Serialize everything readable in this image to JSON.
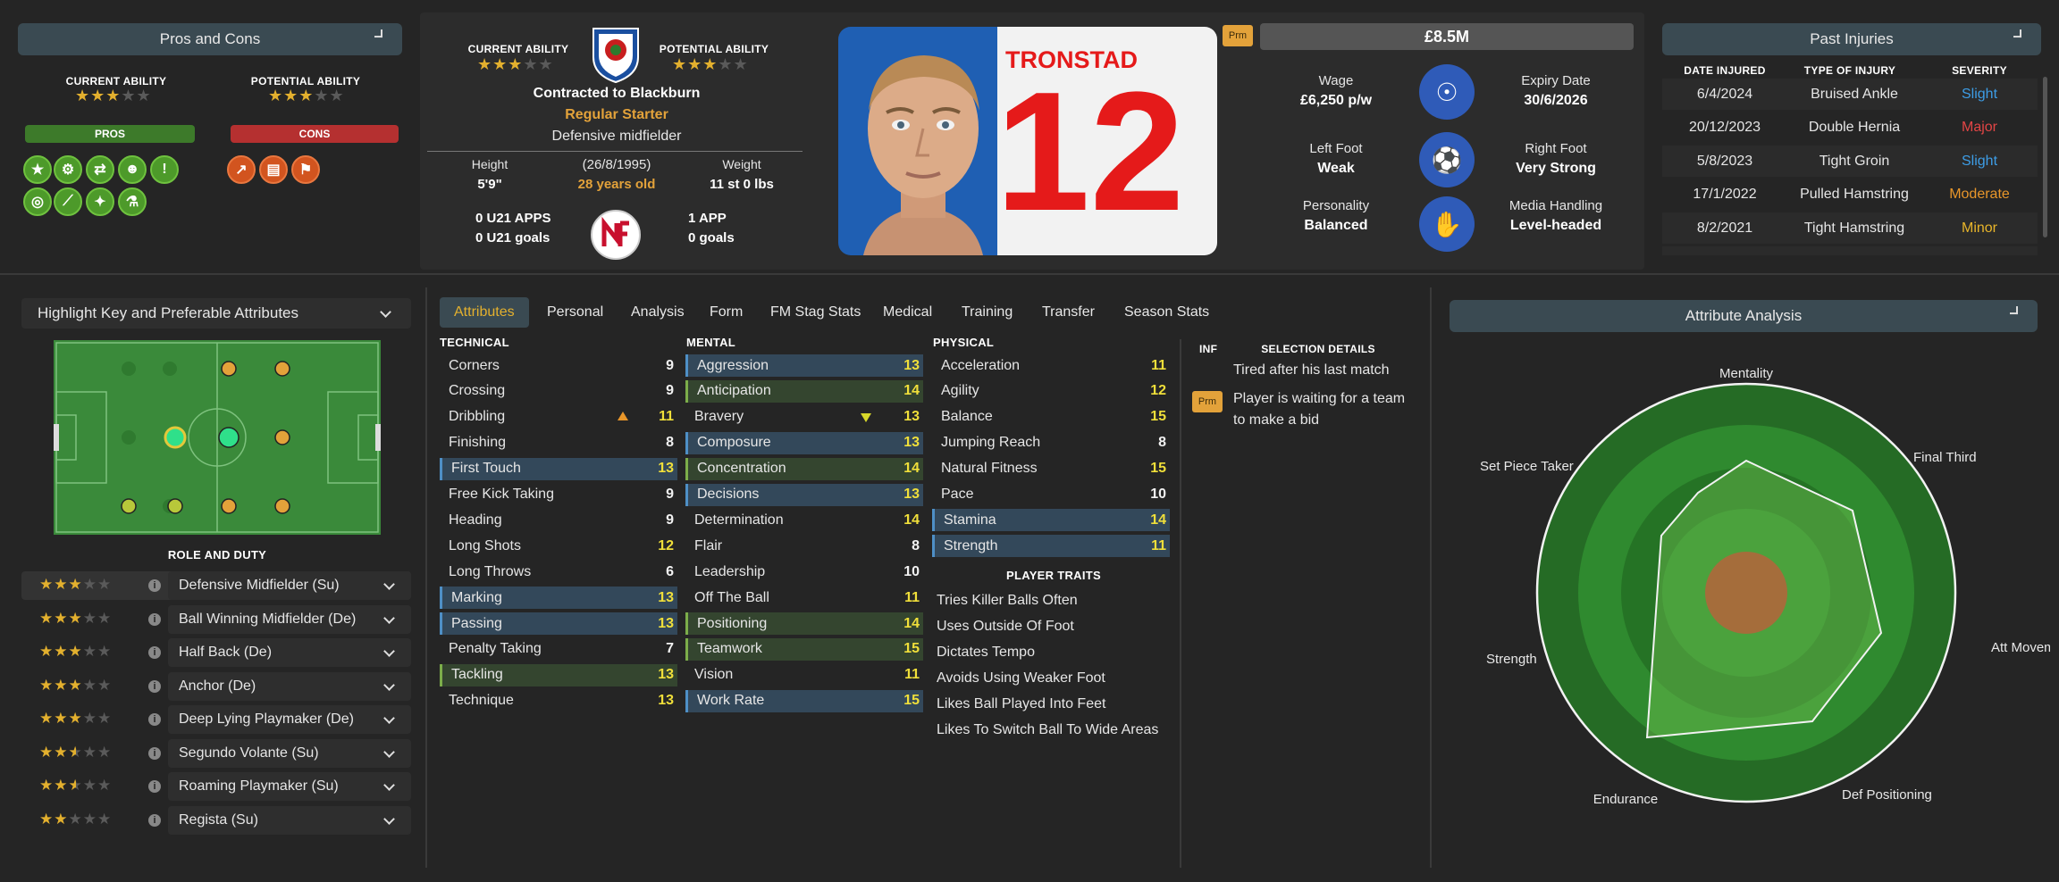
{
  "pros_cons": {
    "header": "Pros and Cons",
    "current_ability_label": "CURRENT ABILITY",
    "potential_ability_label": "POTENTIAL ABILITY",
    "pros_label": "PROS",
    "cons_label": "CONS",
    "current_stars": 3,
    "potential_stars": 3
  },
  "profile": {
    "current_ability_label": "CURRENT ABILITY",
    "potential_ability_label": "POTENTIAL ABILITY",
    "contract": "Contracted to Blackburn",
    "status": "Regular Starter",
    "position": "Defensive midfielder",
    "height_label": "Height",
    "height": "5'9\"",
    "dob": "(26/8/1995)",
    "age": "28 years old",
    "weight_label": "Weight",
    "weight": "11 st 0 lbs",
    "u21_apps": "0 U21 APPS",
    "u21_goals": "0 U21 goals",
    "apps": "1 APP",
    "goals": "0 goals",
    "shirt_name": "TRONSTAD",
    "shirt_number": "12"
  },
  "value": {
    "badge": "Prm",
    "amount": "£8.5M"
  },
  "contract": {
    "wage_label": "Wage",
    "wage": "£6,250 p/w",
    "expiry_label": "Expiry Date",
    "expiry": "30/6/2026",
    "left_foot_label": "Left Foot",
    "left_foot": "Weak",
    "right_foot_label": "Right Foot",
    "right_foot": "Very Strong",
    "personality_label": "Personality",
    "personality": "Balanced",
    "media_label": "Media Handling",
    "media": "Level-headed"
  },
  "injuries": {
    "header": "Past Injuries",
    "cols": [
      "DATE INJURED",
      "TYPE OF INJURY",
      "SEVERITY"
    ],
    "rows": [
      {
        "date": "6/4/2024",
        "type": "Bruised Ankle",
        "sev": "Slight",
        "color": "#3d9de6"
      },
      {
        "date": "20/12/2023",
        "type": "Double Hernia",
        "sev": "Major",
        "color": "#e24545"
      },
      {
        "date": "5/8/2023",
        "type": "Tight Groin",
        "sev": "Slight",
        "color": "#3d9de6"
      },
      {
        "date": "17/1/2022",
        "type": "Pulled Hamstring",
        "sev": "Moderate",
        "color": "#e8962a"
      },
      {
        "date": "8/2/2021",
        "type": "Tight Hamstring",
        "sev": "Minor",
        "color": "#e8b52a"
      }
    ]
  },
  "highlight": {
    "header": "Highlight Key and Preferable Attributes",
    "role_duty_label": "ROLE AND DUTY"
  },
  "roles": [
    {
      "name": "Defensive Midfielder (Su)",
      "stars": 3
    },
    {
      "name": "Ball Winning Midfielder (De)",
      "stars": 3
    },
    {
      "name": "Half Back (De)",
      "stars": 3
    },
    {
      "name": "Anchor (De)",
      "stars": 3
    },
    {
      "name": "Deep Lying Playmaker (De)",
      "stars": 3
    },
    {
      "name": "Segundo Volante (Su)",
      "stars": 2.5
    },
    {
      "name": "Roaming Playmaker (Su)",
      "stars": 2.5
    },
    {
      "name": "Regista (Su)",
      "stars": 2
    }
  ],
  "tabs": [
    "Attributes",
    "Personal",
    "Analysis",
    "Form",
    "FM Stag Stats",
    "Medical",
    "Training",
    "Transfer",
    "Season Stats"
  ],
  "technical": {
    "label": "TECHNICAL",
    "items": [
      {
        "n": "Corners",
        "v": "9"
      },
      {
        "n": "Crossing",
        "v": "9"
      },
      {
        "n": "Dribbling",
        "v": "11"
      },
      {
        "n": "Finishing",
        "v": "8"
      },
      {
        "n": "First Touch",
        "v": "13"
      },
      {
        "n": "Free Kick Taking",
        "v": "9"
      },
      {
        "n": "Heading",
        "v": "9"
      },
      {
        "n": "Long Shots",
        "v": "12"
      },
      {
        "n": "Long Throws",
        "v": "6"
      },
      {
        "n": "Marking",
        "v": "13"
      },
      {
        "n": "Passing",
        "v": "13"
      },
      {
        "n": "Penalty Taking",
        "v": "7"
      },
      {
        "n": "Tackling",
        "v": "13"
      },
      {
        "n": "Technique",
        "v": "13"
      }
    ]
  },
  "mental": {
    "label": "MENTAL",
    "items": [
      {
        "n": "Aggression",
        "v": "13"
      },
      {
        "n": "Anticipation",
        "v": "14"
      },
      {
        "n": "Bravery",
        "v": "13"
      },
      {
        "n": "Composure",
        "v": "13"
      },
      {
        "n": "Concentration",
        "v": "14"
      },
      {
        "n": "Decisions",
        "v": "13"
      },
      {
        "n": "Determination",
        "v": "14"
      },
      {
        "n": "Flair",
        "v": "8"
      },
      {
        "n": "Leadership",
        "v": "10"
      },
      {
        "n": "Off The Ball",
        "v": "11"
      },
      {
        "n": "Positioning",
        "v": "14"
      },
      {
        "n": "Teamwork",
        "v": "15"
      },
      {
        "n": "Vision",
        "v": "11"
      },
      {
        "n": "Work Rate",
        "v": "15"
      }
    ]
  },
  "physical": {
    "label": "PHYSICAL",
    "items": [
      {
        "n": "Acceleration",
        "v": "11"
      },
      {
        "n": "Agility",
        "v": "12"
      },
      {
        "n": "Balance",
        "v": "15"
      },
      {
        "n": "Jumping Reach",
        "v": "8"
      },
      {
        "n": "Natural Fitness",
        "v": "15"
      },
      {
        "n": "Pace",
        "v": "10"
      },
      {
        "n": "Stamina",
        "v": "14"
      },
      {
        "n": "Strength",
        "v": "11"
      }
    ]
  },
  "traits": {
    "label": "PLAYER TRAITS",
    "items": [
      "Tries Killer Balls Often",
      "Uses Outside Of Foot",
      "Dictates Tempo",
      "Avoids Using Weaker Foot",
      "Likes Ball Played Into Feet",
      "Likes To Switch Ball To Wide Areas"
    ]
  },
  "selection": {
    "inf_label": "INF",
    "label": "SELECTION DETAILS",
    "line1": "Tired after his last match",
    "badge": "Prm",
    "line2a": "Player is waiting for a team",
    "line2b": "to make a bid"
  },
  "analysis": {
    "header": "Attribute Analysis",
    "axes": [
      "Mentality",
      "Final Third",
      "Att Movement",
      "Def Positioning",
      "Endurance",
      "Strength",
      "Set Piece Taker"
    ]
  },
  "colors": {
    "accent": "#e3b02e",
    "panel": "#2c2c2c",
    "bar": "#3a4a52",
    "pitch": "#3a8a3a"
  }
}
